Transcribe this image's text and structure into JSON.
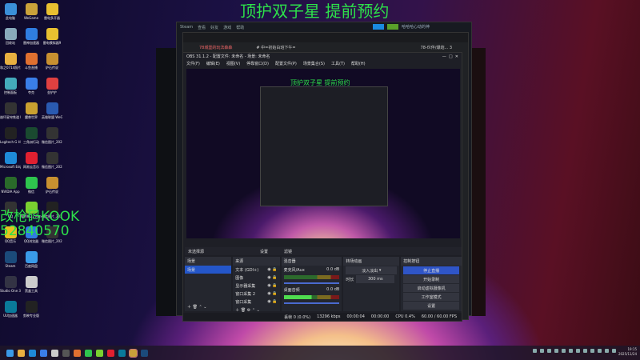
{
  "desktop": {
    "icons": [
      "此电脑",
      "WeGame",
      "雷电多开器",
      "回收站",
      "雷神加速器",
      "雷电模拟器9",
      "和之0714照片",
      "斗鱼直播",
      "炉石传说",
      "控制面板",
      "夸克",
      "金铲铲",
      "崩坏星穹铁道 Dark an...",
      "魔兽世界",
      "英雄联盟 WeGame版",
      "Logitech G HUB",
      "三角洲行动",
      "微信图片_2025111...",
      "Microsoft Edge",
      "网易云音乐",
      "微信图片_2025111...",
      "NVIDIA App",
      "微信",
      "炉石传说",
      "QQ",
      "NMXA22 Panel",
      "微信图片_2025111...",
      "QQ音乐",
      "QQ浏览器",
      "微信图片_2025111...",
      "Steam",
      "百度网盘",
      "",
      "Studio One 3.5专业版",
      "黑盒工具",
      "",
      "UU加速器",
      "剪映专业版",
      ""
    ],
    "icon_colors": [
      "#3a8fd8",
      "#c9a23a",
      "#e8c030",
      "#8ab",
      "#2f7de0",
      "#e8c030",
      "#e8b040",
      "#e07030",
      "#c89030",
      "#4ab",
      "#3a7ee8",
      "#e04040",
      "#333",
      "#c9a030",
      "#2a5ab0",
      "#222",
      "#1a4a30",
      "#333",
      "#1e8ad8",
      "#e02030",
      "#333",
      "#2a6a2a",
      "#2ec44e",
      "#c89030",
      "#333",
      "#7ad030",
      "#222",
      "#e8c020",
      "#2f7de0",
      "#333",
      "#1b4a7a",
      "#3a9ae8",
      "",
      "#334",
      "#ccc",
      "",
      "#0a7a9a",
      "#222",
      ""
    ]
  },
  "overlay": {
    "title": "顶护双子星 提前预约",
    "kook_line1": "改枪码KOOK",
    "kook_line2": "52840570"
  },
  "steam": {
    "menu": [
      "Steam",
      "查看",
      "好友",
      "游戏",
      "帮助"
    ],
    "user": "哈哈哈心动的神"
  },
  "kook": {
    "channel": "78城堡的玩法森森",
    "room": "# 中=初始白班下午=",
    "member": "78-伙伴/爆炮... 3"
  },
  "obs": {
    "title": "OBS 31.1.2 - 配置文件: 未命名 - 场景: 未命名",
    "menu": [
      "文件(F)",
      "编辑(E)",
      "视图(V)",
      "停靠窗口(D)",
      "配置文件(P)",
      "场景集合(S)",
      "工具(T)",
      "帮助(H)"
    ],
    "preview_title": "顶护双子星 提前预约",
    "source_bar": {
      "label": "未选择源",
      "properties": "设置",
      "filters": "滤镜"
    },
    "scenes": {
      "title": "场景",
      "items": [
        "场景"
      ]
    },
    "sources": {
      "title": "来源",
      "items": [
        "文本 (GDI+)",
        "图像",
        "显示器采集",
        "窗口采集 2",
        "窗口采集"
      ]
    },
    "mixer": {
      "title": "混音器",
      "channels": [
        {
          "name": "麦克风/Aux",
          "db": "0.0 dB"
        },
        {
          "name": "桌面音频",
          "db": "0.0 dB"
        }
      ]
    },
    "transitions": {
      "title": "转场动画",
      "type": "淡入淡出",
      "duration_label": "时长",
      "duration": "300 ms"
    },
    "controls": {
      "title": "控制按钮",
      "buttons": [
        "停止直播",
        "开始录制",
        "启动虚拟摄像机",
        "工作室模式",
        "设置"
      ]
    },
    "status": {
      "dropped": "丢帧 0 (0.0%)",
      "bitrate": "13296 kbps",
      "stream_time": "00:00:04",
      "rec_time": "00:00:00",
      "cpu": "CPU 0.4%",
      "fps": "60.00 / 60.00 FPS"
    }
  },
  "taskbar": {
    "time": "19:15",
    "date": "2025/11/24"
  },
  "colors": {
    "accent_green": "#2de04a",
    "obs_blue": "#2f55c7"
  }
}
